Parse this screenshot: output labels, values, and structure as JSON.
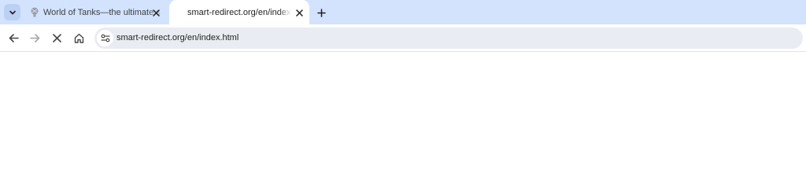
{
  "tabs": [
    {
      "title": "World of Tanks—the ultimate s",
      "favicon": "tank-icon",
      "active": false
    },
    {
      "title": "smart-redirect.org/en/index.htm",
      "favicon": "none",
      "active": true
    }
  ],
  "toolbar": {
    "url": "smart-redirect.org/en/index.html",
    "back_icon": "back-arrow-icon",
    "forward_icon": "forward-arrow-icon",
    "stop_icon": "stop-icon",
    "home_icon": "home-icon",
    "site_info_icon": "site-info-icon"
  },
  "colors": {
    "tabstrip": "#d3e3fd",
    "omnibox": "#e9ecf2",
    "icon": "#474747"
  }
}
